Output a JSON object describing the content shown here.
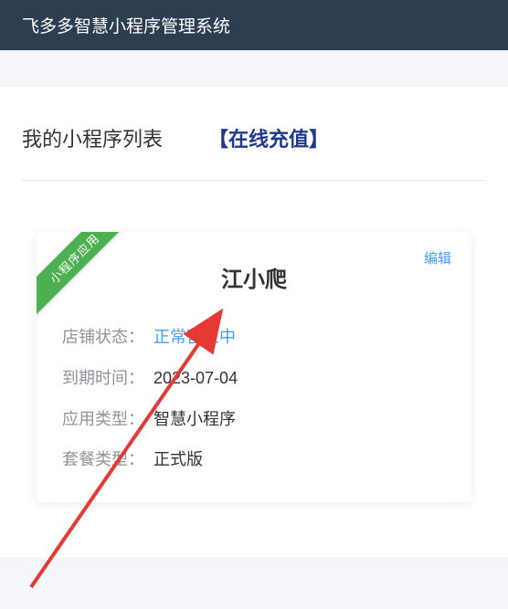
{
  "header": {
    "system_name": "飞多多智慧小程序管理系统"
  },
  "page": {
    "title": "我的小程序列表",
    "recharge_link": "【在线充值】"
  },
  "card": {
    "ribbon": "小程序应用",
    "edit": "编辑",
    "title": "江小爬",
    "rows": [
      {
        "label": "店铺状态：",
        "value": "正常营业中",
        "status": "open"
      },
      {
        "label": "到期时间：",
        "value": "2023-07-04"
      },
      {
        "label": "应用类型：",
        "value": "智慧小程序"
      },
      {
        "label": "套餐类型：",
        "value": "正式版"
      }
    ]
  },
  "colors": {
    "header_bg": "#2c3e50",
    "accent_blue": "#409eff",
    "ribbon_green": "#4caf50",
    "link_navy": "#1e3a8a"
  }
}
